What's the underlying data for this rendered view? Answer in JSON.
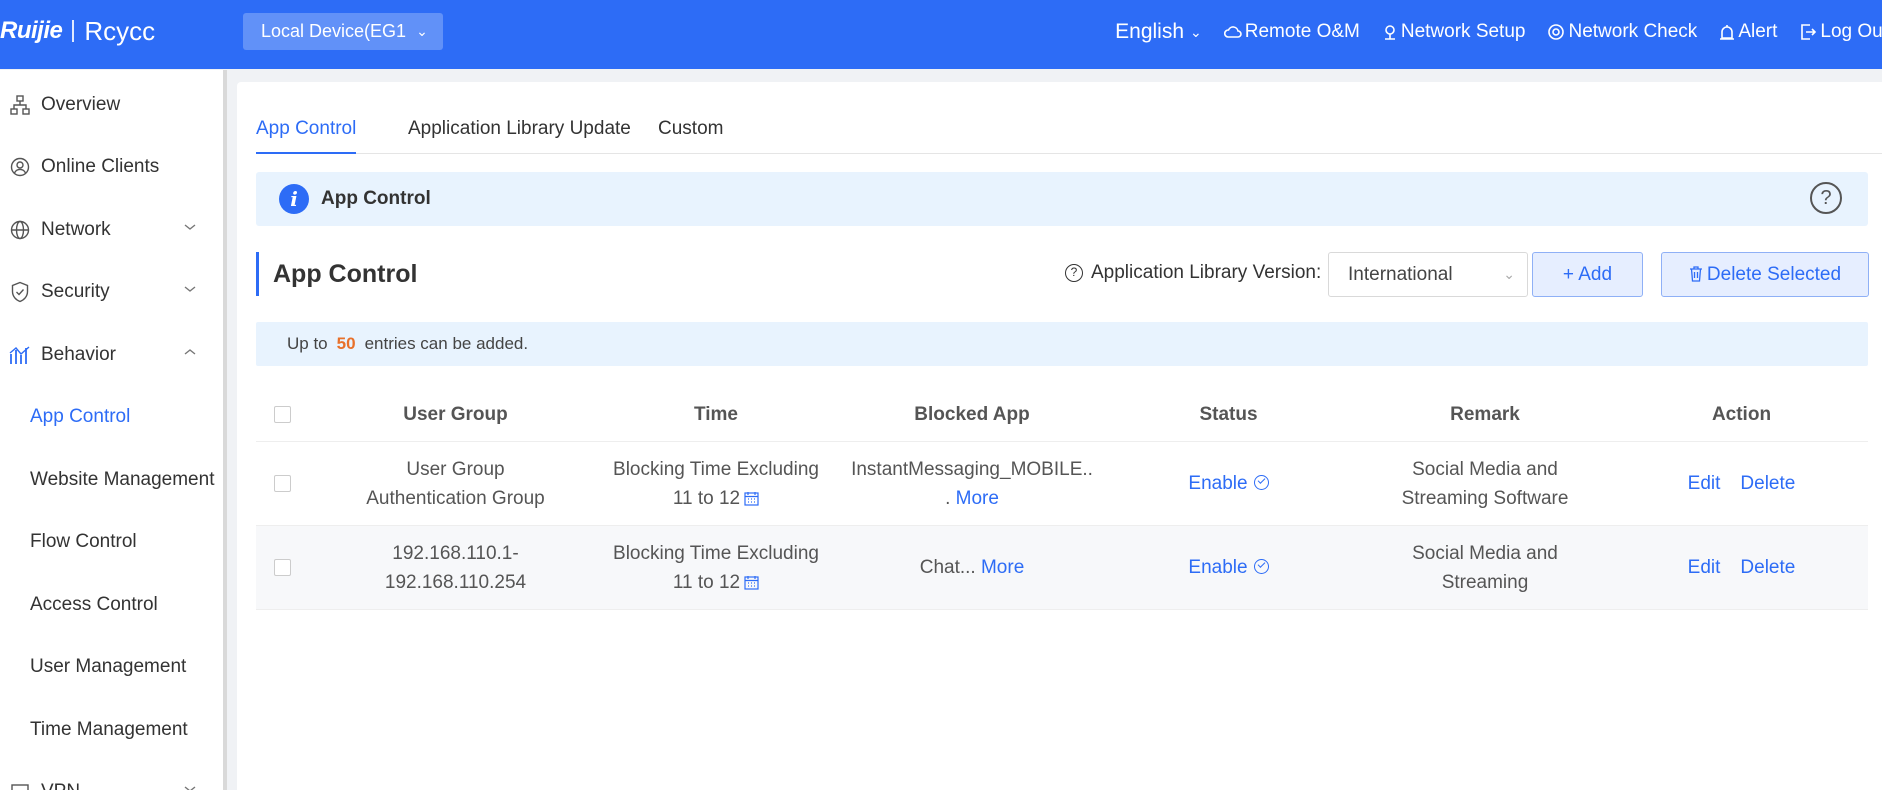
{
  "header": {
    "logo_text": "Ruijie",
    "logo_sub": "Rcycc",
    "device_select": "Local Device(EG1",
    "language": "English",
    "nav": {
      "remote": "Remote O&M",
      "setup": "Network Setup",
      "check": "Network Check",
      "alert": "Alert",
      "logout": "Log Out"
    },
    "accent_color": "#2d6cf6"
  },
  "sidebar": {
    "items": [
      {
        "label": "Overview",
        "icon": "topology-icon"
      },
      {
        "label": "Online Clients",
        "icon": "user-circle-icon"
      },
      {
        "label": "Network",
        "icon": "globe-icon"
      },
      {
        "label": "Security",
        "icon": "shield-icon"
      },
      {
        "label": "Behavior",
        "icon": "chart-icon"
      }
    ],
    "sub_items": [
      "App Control",
      "Website Management",
      "Flow Control",
      "Access Control",
      "User Management",
      "Time Management"
    ],
    "partial_item": "VPN"
  },
  "tabs": [
    "App Control",
    "Application Library Update",
    "Custom"
  ],
  "banner": {
    "title": "App Control"
  },
  "section": {
    "title": "App Control",
    "lib_label": "Application Library Version:",
    "lib_value": "International",
    "add_label": "+ Add",
    "delete_label": "Delete Selected"
  },
  "notice": {
    "prefix": "Up to",
    "count": "50",
    "suffix": "entries can be added."
  },
  "table": {
    "headers": [
      "User Group",
      "Time",
      "Blocked App",
      "Status",
      "Remark",
      "Action"
    ],
    "rows": [
      {
        "user_group": "User Group Authentication Group",
        "time": "Blocking Time Excluding 11 to 12",
        "blocked_app": "InstantMessaging_MOBILE..",
        "blocked_app_tail": ".",
        "more": "More",
        "status": "Enable",
        "remark": "Social Media and Streaming Software",
        "edit": "Edit",
        "delete": "Delete"
      },
      {
        "user_group": "192.168.110.1-192.168.110.254",
        "time": "Blocking Time Excluding 11 to 12",
        "blocked_app": "Chat...",
        "blocked_app_tail": "",
        "more": "More",
        "status": "Enable",
        "remark": "Social Media and Streaming",
        "edit": "Edit",
        "delete": "Delete"
      }
    ]
  }
}
